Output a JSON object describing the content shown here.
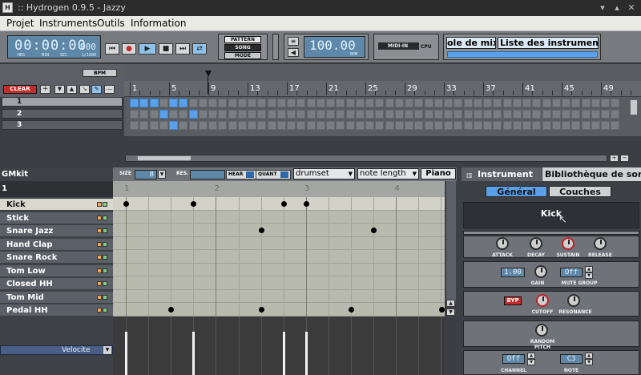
{
  "window": {
    "title": ":: Hydrogen 0.9.5 - Jazzy"
  },
  "menu": [
    "Projet",
    "Instruments",
    "Outils",
    "Information"
  ],
  "transport": {
    "time": "00:00:00",
    "millis": "000",
    "time_labels": [
      "HRS",
      "MIN",
      "SEC",
      "1/1000"
    ],
    "mode_pattern": "PATTERN",
    "mode_song": "SONG",
    "mode_label": "MODE",
    "bpm_value": "100.00",
    "bpm_label": "BPM",
    "midi_in": "MIDI-IN",
    "cpu": "CPU",
    "tab_mixer": "ole de mixa",
    "tab_instruments": "Liste des instruments"
  },
  "song_editor": {
    "bpm_button": "BPM",
    "clear_button": "CLEAR",
    "patterns": [
      "1",
      "2",
      "3"
    ],
    "ruler": [
      "1",
      "5",
      "9",
      "13",
      "17",
      "21",
      "25",
      "29",
      "33",
      "37",
      "41",
      "45",
      "49"
    ],
    "active_cells": {
      "0": [
        0,
        1,
        2,
        4,
        5
      ],
      "1": [
        3,
        6
      ],
      "2": [
        4
      ]
    }
  },
  "pattern_editor": {
    "kit_name": "GMkit",
    "pattern_number": "1",
    "size_label": "SIZE",
    "size_value": "8",
    "res_label": "RES.",
    "hear_label": "HEAR",
    "quant_label": "QUANT",
    "pattern_select": "drumset",
    "note_length": "note length",
    "piano_button": "Piano",
    "ruler": [
      "1",
      "2",
      "3",
      "4"
    ],
    "velocity_label": "Velocite",
    "instruments": [
      "Kick",
      "Stick",
      "Snare Jazz",
      "Hand Clap",
      "Snare Rock",
      "Tom Low",
      "Closed HH",
      "Tom Mid",
      "Pedal HH"
    ],
    "notes": {
      "0": [
        0,
        0.75,
        1.75,
        2
      ],
      "2": [
        1.5,
        2.75
      ],
      "8": [
        0.5,
        1.5,
        2.5,
        3.5
      ]
    }
  },
  "instrument_panel": {
    "tab_instrument": "Instrument",
    "tab_library": "Bibliothèque de sons",
    "subtab_general": "Général",
    "subtab_layers": "Couches",
    "name": "Kick",
    "envelope": [
      "ATTACK",
      "DECAY",
      "SUSTAIN",
      "RELEASE"
    ],
    "gain_value": "1.00",
    "gain_label": "GAIN",
    "mute_value": "Off",
    "mute_label": "MUTE GROUP",
    "byp_label": "BYP",
    "cutoff_label": "CUTOFF",
    "resonance_label": "RESONANCE",
    "random_pitch_label": "RANDOM PITCH",
    "channel_value": "Off",
    "channel_label": "CHANNEL",
    "note_value": "C3",
    "note_label": "NOTE"
  },
  "colors": {
    "accent": "#5aa0ea",
    "lcd": "#5f88a8",
    "bypass": "#c42b2b"
  }
}
